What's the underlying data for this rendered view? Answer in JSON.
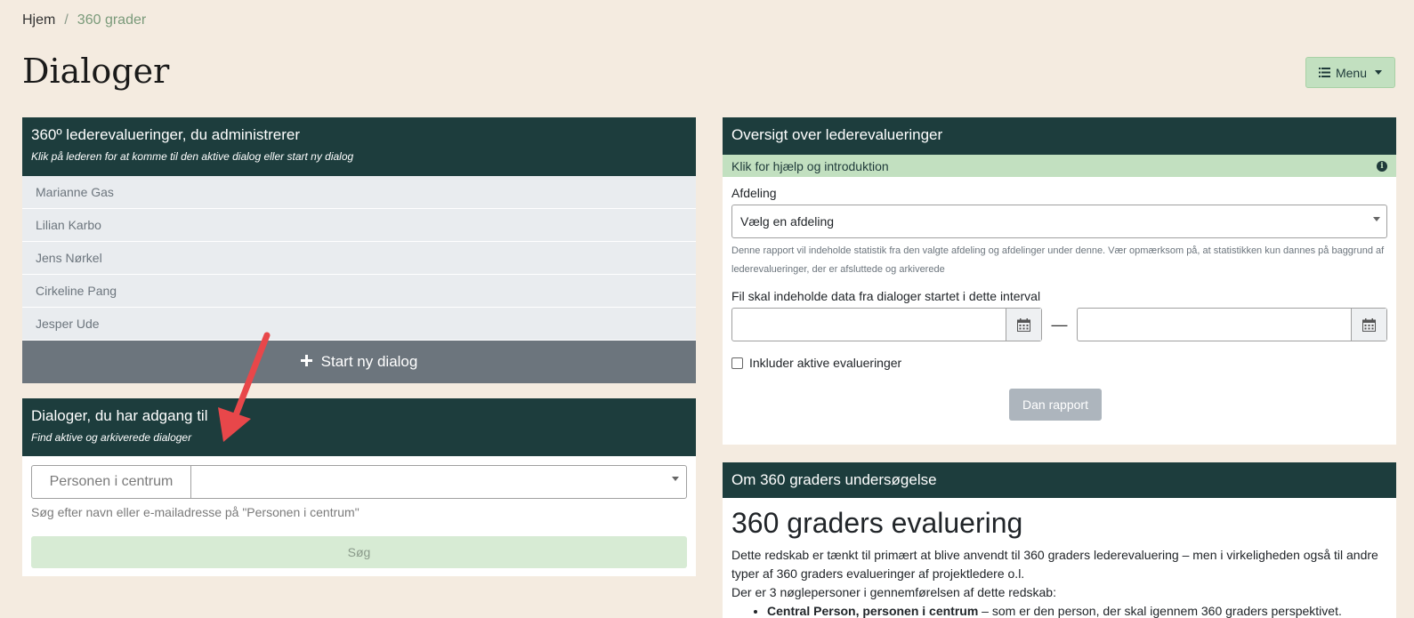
{
  "breadcrumb": {
    "home": "Hjem",
    "separator": "/",
    "current": "360 grader"
  },
  "page_title": "Dialoger",
  "menu": {
    "label": "Menu"
  },
  "leaders_panel": {
    "title": "360º lederevalueringer, du administrerer",
    "subtitle": "Klik på lederen for at komme til den aktive dialog eller start ny dialog",
    "leaders": [
      "Marianne Gas",
      "Lilian Karbo",
      "Jens Nørkel",
      "Cirkeline Pang",
      "Jesper Ude"
    ],
    "start_button": "Start ny dialog"
  },
  "access_panel": {
    "title": "Dialoger, du har adgang til",
    "subtitle": "Find aktive og arkiverede dialoger",
    "search_addon": "Personen i centrum",
    "help": "Søg efter navn eller e-mailadresse på \"Personen i centrum\"",
    "search_button": "Søg"
  },
  "overview_panel": {
    "title": "Oversigt over lederevalueringer",
    "help_bar": "Klik for hjælp og introduktion",
    "department_label": "Afdeling",
    "department_value": "Vælg en afdeling",
    "department_note": "Denne rapport vil indeholde statistik fra den valgte afdeling og afdelinger under denne. Vær opmærksom på, at statistikken kun dannes på baggrund af lederevalueringer, der er afsluttede og arkiverede",
    "interval_label": "Fil skal indeholde data fra dialoger startet i dette interval",
    "dash": "—",
    "include_active": "Inkluder aktive evalueringer",
    "report_button": "Dan rapport"
  },
  "about_panel": {
    "title": "Om 360 graders undersøgelse",
    "heading": "360 graders evaluering",
    "paragraph": "Dette redskab er tænkt til primært at blive anvendt til 360 graders lederevaluering – men i virkeligheden også til andre typer af 360 graders evalueringer af projektledere o.l.",
    "intro_line": "Der er 3 nøglepersoner i gennemførelsen af dette redskab:",
    "bullet_bold": "Central Person, personen i centrum",
    "bullet_rest": " – som er den person, der skal igennem 360 graders perspektivet."
  },
  "colors": {
    "header": "#1d3d3d",
    "accent_green": "#c2e0c0",
    "arrow": "#e8474a"
  }
}
